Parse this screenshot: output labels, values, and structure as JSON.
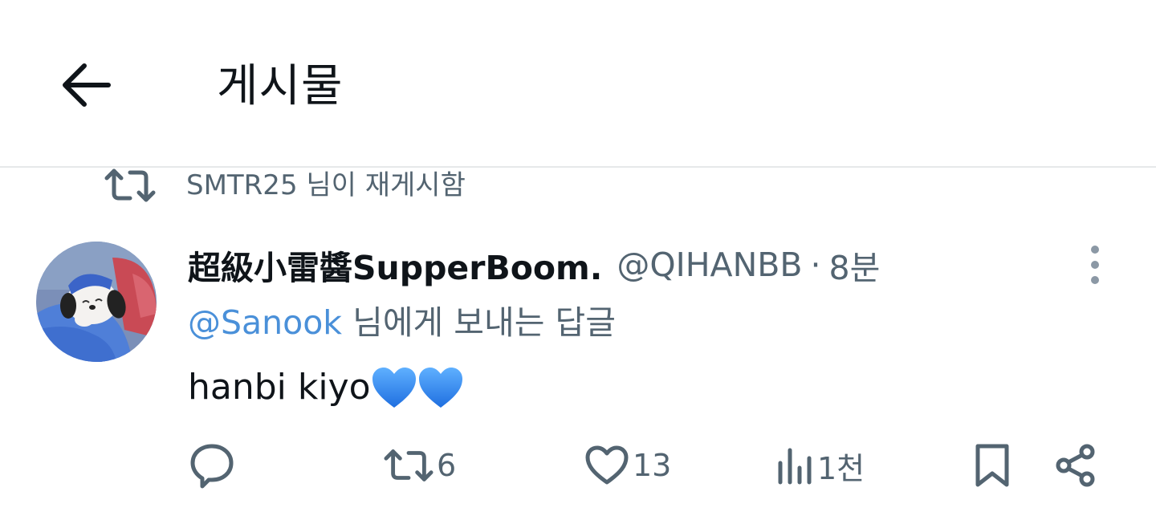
{
  "header": {
    "title": "게시물",
    "back_icon": "arrow-left-icon"
  },
  "repost_context": {
    "icon": "repost-icon",
    "text": "SMTR25 님이 재게시함"
  },
  "tweet": {
    "display_name": "超級小雷醬SupperBoom.",
    "handle": "@QIHANBB",
    "separator": "·",
    "time": "8분",
    "reply_to_mention": "@Sanook",
    "reply_to_suffix": " 님에게 보내는 답글",
    "text": "hanbi kiyo",
    "emoji_icons": [
      "blue-heart-icon",
      "blue-heart-icon"
    ]
  },
  "actions": {
    "reply": {
      "icon": "reply-icon",
      "count": ""
    },
    "repost": {
      "icon": "repost-icon",
      "count": "6"
    },
    "like": {
      "icon": "heart-icon",
      "count": "13"
    },
    "views": {
      "icon": "views-icon",
      "count": "1천"
    },
    "bookmark": {
      "icon": "bookmark-icon"
    },
    "share": {
      "icon": "share-icon"
    }
  },
  "colors": {
    "text_primary": "#0f1419",
    "text_secondary": "#536471",
    "mention": "#4a90d9",
    "divider": "#e6e8ea",
    "heart_emoji": "#3a8ff0"
  }
}
